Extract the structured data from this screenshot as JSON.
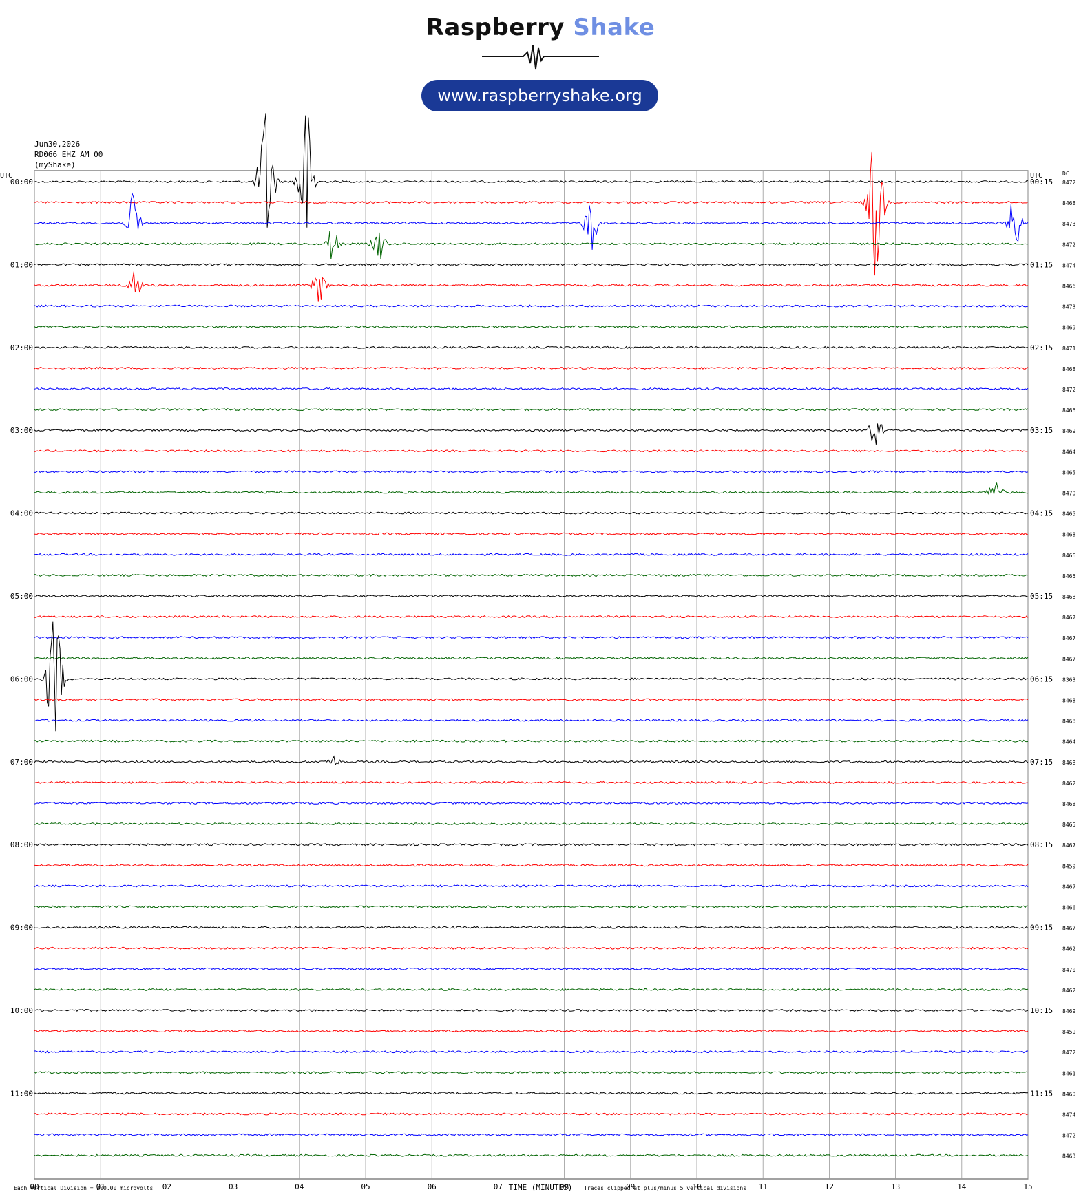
{
  "brand": {
    "name_part1": "Raspberry",
    "name_part2": "Shake",
    "url": "www.raspberryshake.org"
  },
  "header": {
    "date": "Jun30,2026",
    "station": "RD066 EHZ AM 00",
    "source": "(myShake)"
  },
  "colors": {
    "trace_cycle": [
      "#000000",
      "#ff0000",
      "#0000ff",
      "#006400"
    ],
    "grid": "#999999",
    "logo_dark": "#111111",
    "logo_light": "#6f8fe3",
    "badge_bg": "#1a3996"
  },
  "chart_data": {
    "type": "helicorder",
    "left_axis_title": "UTC",
    "right_axis_title": "UTC",
    "dc_column_title": "DC",
    "xlabel": "TIME (MINUTES)",
    "x_ticks": [
      "00",
      "01",
      "02",
      "03",
      "04",
      "05",
      "06",
      "07",
      "08",
      "09",
      "10",
      "11",
      "12",
      "13",
      "14",
      "15"
    ],
    "xlim": [
      0,
      15
    ],
    "left_labels": [
      "00:00",
      "01:00",
      "02:00",
      "03:00",
      "04:00",
      "05:00",
      "06:00",
      "07:00",
      "08:00",
      "09:00",
      "10:00",
      "11:00"
    ],
    "right_labels": [
      "00:15",
      "01:15",
      "02:15",
      "03:15",
      "04:15",
      "05:15",
      "06:15",
      "07:15",
      "08:15",
      "09:15",
      "10:15",
      "11:15"
    ],
    "dc_values": [
      "8472",
      "8468",
      "8473",
      "8472",
      "8474",
      "8466",
      "8473",
      "8469",
      "8471",
      "8468",
      "8472",
      "8466",
      "8469",
      "8464",
      "8465",
      "8470",
      "8465",
      "8468",
      "8466",
      "8465",
      "8468",
      "8467",
      "8467",
      "8467",
      "8363",
      "8468",
      "8468",
      "8464",
      "8468",
      "8462",
      "8468",
      "8465",
      "8467",
      "8459",
      "8467",
      "8466",
      "8467",
      "8462",
      "8470",
      "8462",
      "8469",
      "8459",
      "8472",
      "8461",
      "8460",
      "8474",
      "8472",
      "8463"
    ],
    "events": [
      {
        "row": 0,
        "minute": 3.5,
        "amp": "clipped"
      },
      {
        "row": 0,
        "minute": 4.1,
        "amp": "clipped"
      },
      {
        "row": 1,
        "minute": 12.7,
        "amp": "clipped"
      },
      {
        "row": 2,
        "minute": 1.5,
        "amp": "large"
      },
      {
        "row": 2,
        "minute": 8.4,
        "amp": "large"
      },
      {
        "row": 2,
        "minute": 14.8,
        "amp": "large"
      },
      {
        "row": 3,
        "minute": 4.5,
        "amp": "medium"
      },
      {
        "row": 3,
        "minute": 5.2,
        "amp": "medium"
      },
      {
        "row": 5,
        "minute": 1.5,
        "amp": "medium"
      },
      {
        "row": 5,
        "minute": 4.3,
        "amp": "medium"
      },
      {
        "row": 12,
        "minute": 12.7,
        "amp": "medium"
      },
      {
        "row": 15,
        "minute": 14.5,
        "amp": "medium"
      },
      {
        "row": 24,
        "minute": 0.3,
        "amp": "clipped"
      },
      {
        "row": 28,
        "minute": 4.5,
        "amp": "small"
      }
    ],
    "footer_left": "Each Vertical Division =  200.00 microvolts",
    "footer_right": "Traces clipped at plus/minus 5 vertical divisions"
  }
}
